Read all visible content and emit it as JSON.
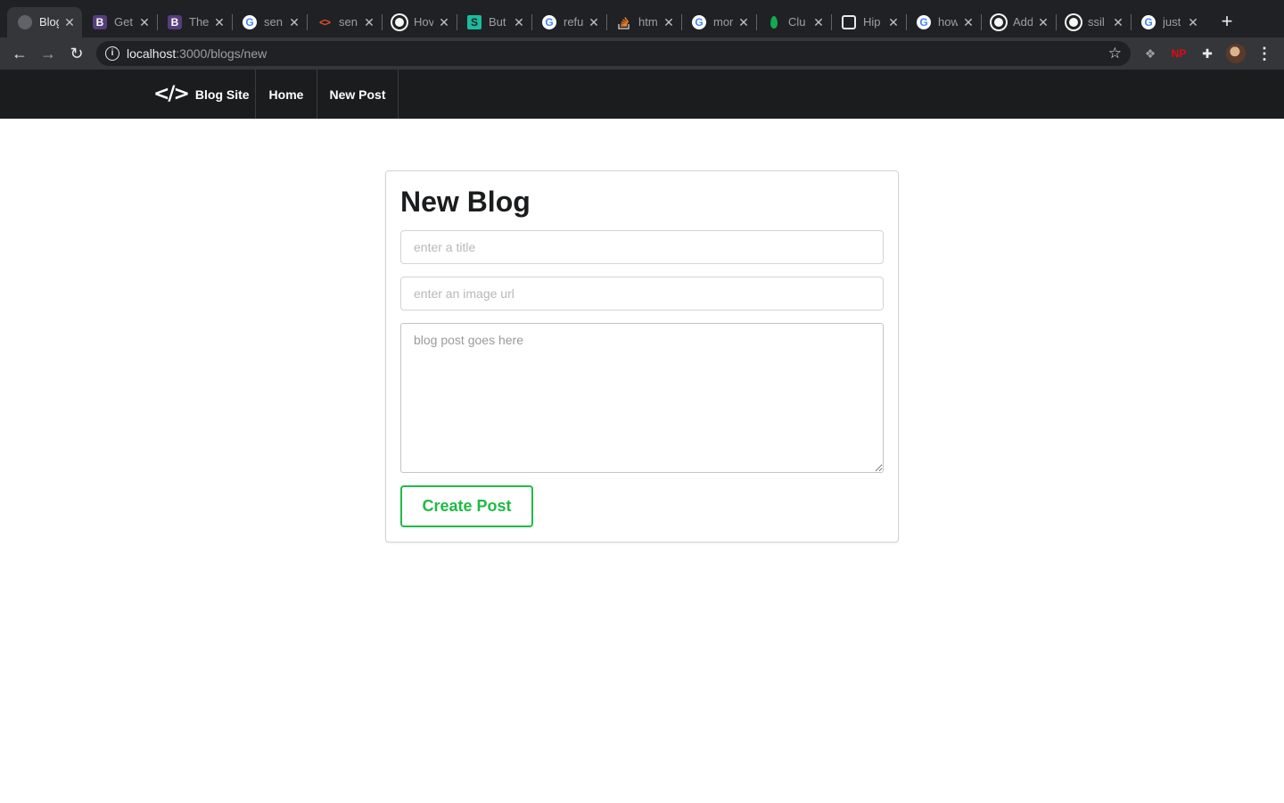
{
  "browser": {
    "tabs": [
      {
        "title": "Blog",
        "icon": "globe-icon",
        "active": true
      },
      {
        "title": "Get",
        "icon": "bootstrap-icon"
      },
      {
        "title": "The",
        "icon": "bootstrap-icon"
      },
      {
        "title": "sen",
        "icon": "google-icon"
      },
      {
        "title": "sen",
        "icon": "code-icon"
      },
      {
        "title": "Hov",
        "icon": "github-icon"
      },
      {
        "title": "But",
        "icon": "s-icon"
      },
      {
        "title": "refu",
        "icon": "google-icon"
      },
      {
        "title": "htm",
        "icon": "stackoverflow-icon"
      },
      {
        "title": "mor",
        "icon": "google-icon"
      },
      {
        "title": "Clu",
        "icon": "mongodb-leaf-icon"
      },
      {
        "title": "Hip",
        "icon": "hip-icon"
      },
      {
        "title": "how",
        "icon": "google-icon"
      },
      {
        "title": "Add",
        "icon": "github-icon"
      },
      {
        "title": "ssil",
        "icon": "github-icon"
      },
      {
        "title": "just",
        "icon": "google-icon"
      }
    ],
    "close_glyph": "✕",
    "new_tab_glyph": "+",
    "url_host": "localhost",
    "url_path": ":3000/blogs/new",
    "extensions": {
      "np_label": "NP"
    }
  },
  "site_nav": {
    "brand_label": "Blog Site",
    "home_label": "Home",
    "new_post_label": "New Post"
  },
  "form": {
    "heading": "New Blog",
    "title_placeholder": "enter a title",
    "image_placeholder": "enter an image url",
    "body_placeholder": "blog post goes here",
    "submit_label": "Create Post",
    "accent_color": "#21ba45"
  }
}
